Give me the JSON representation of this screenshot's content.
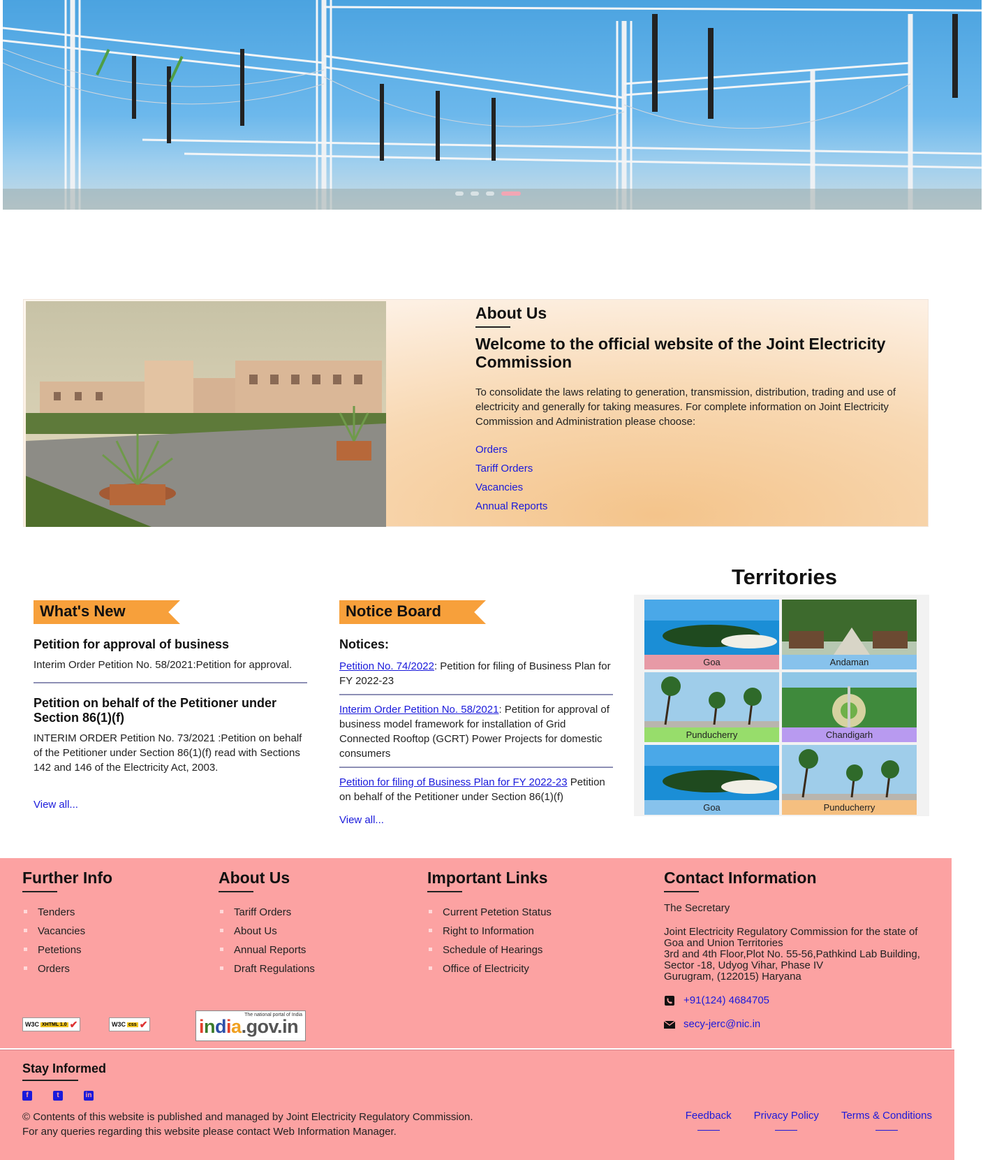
{
  "hero": {
    "slides_count": 4,
    "active_slide": 4
  },
  "about": {
    "heading": "About Us",
    "title": "Welcome to the official website of the Joint Electricity Commission",
    "body": "To consolidate the laws relating to generation, transmission, distribution, trading and use of electricity and generally for taking measures. For complete information on Joint Electricity Commission and Administration please choose:",
    "links": [
      "Orders",
      "Tariff Orders",
      "Vacancies",
      "Annual Reports"
    ]
  },
  "whats_new": {
    "title": "What's New",
    "items": [
      {
        "heading": "Petition for approval of business",
        "text": "Interim Order Petition No. 58/2021:Petition for approval."
      },
      {
        "heading": "Petition on behalf of the Petitioner under Section 86(1)(f)",
        "text": "INTERIM ORDER Petition No. 73/2021 :Petition on behalf of the Petitioner under Section 86(1)(f) read with Sections 142 and 146 of the Electricity Act, 2003."
      }
    ],
    "view_all": "View all..."
  },
  "notice_board": {
    "title": "Notice Board",
    "subtitle": "Notices:",
    "items": [
      {
        "link": "Petition No. 74/2022",
        "text": ": Petition for filing of Business Plan for FY 2022-23"
      },
      {
        "link": "Interim Order Petition No. 58/2021",
        "text": ": Petition for approval of business model framework for installation of Grid Connected Rooftop (GCRT) Power Projects for domestic consumers"
      },
      {
        "link": "Petition for filing of Business Plan for FY 2022-23",
        "text": " Petition on behalf of the Petitioner under Section 86(1)(f)"
      }
    ],
    "view_all": "View all..."
  },
  "territories": {
    "title": "Territories",
    "tiles": [
      {
        "name": "Goa",
        "color": "#e79aa6"
      },
      {
        "name": "Andaman",
        "color": "#87c2ec"
      },
      {
        "name": "Punducherry",
        "color": "#97dd6b"
      },
      {
        "name": "Chandigarh",
        "color": "#b89af0"
      },
      {
        "name": "Goa",
        "color": "#87c2ec"
      },
      {
        "name": "Punducherry",
        "color": "#f5bf80"
      }
    ]
  },
  "footer": {
    "further_info": {
      "title": "Further Info",
      "items": [
        "Tenders",
        "Vacancies",
        "Petetions",
        "Orders"
      ]
    },
    "about_us": {
      "title": "About Us",
      "items": [
        "Tariff Orders",
        "About Us",
        "Annual Reports",
        "Draft Regulations"
      ]
    },
    "important_links": {
      "title": "Important Links",
      "items": [
        "Current Petetion Status",
        "Right to Information",
        "Schedule of Hearings",
        "Office of Electricity"
      ]
    },
    "contact": {
      "title": "Contact Information",
      "secretary": "The Secretary",
      "address": [
        "Joint Electricity Regulatory Commission for the state of",
        "Goa and Union Territories",
        "3rd and 4th Floor,Plot No. 55-56,Pathkind Lab Building,",
        "Sector -18, Udyog Vihar, Phase IV",
        "Gurugram, (122015) Haryana"
      ],
      "phone": "+91(124) 4684705",
      "email": "secy-jerc@nic.in"
    },
    "badges": {
      "w3c_xhtml": {
        "w3c": "W3C",
        "tag": "XHTML 1.0"
      },
      "w3c_css": {
        "w3c": "W3C",
        "tag": "css"
      },
      "india_small": "The national portal of India",
      "india_big": "india.gov.in"
    }
  },
  "bottom": {
    "stay_informed": "Stay Informed",
    "socials": [
      "facebook-icon",
      "twitter-icon",
      "linkedin-icon"
    ],
    "copyright_line1": "© Contents of this website is published and managed by Joint Electricity Regulatory Commission.",
    "copyright_line2": "For any queries regarding this website please contact Web Information Manager.",
    "legal_links": [
      "Feedback",
      "Privacy Policy",
      "Terms & Conditions"
    ]
  }
}
